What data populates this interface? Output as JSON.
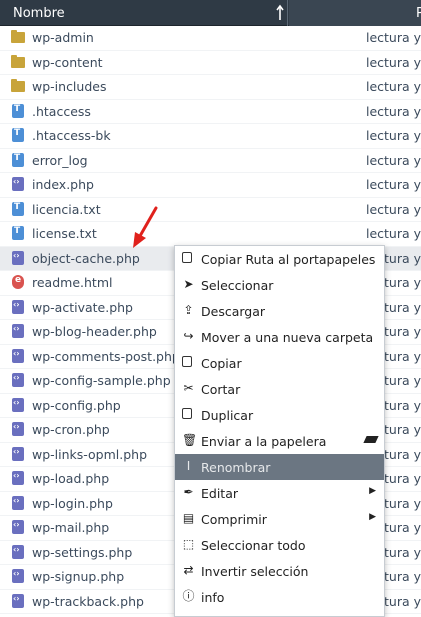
{
  "header": {
    "name_label": "Nombre",
    "perm_label": "P"
  },
  "files": [
    {
      "name": "wp-admin",
      "type": "folder",
      "perm": "lectura y"
    },
    {
      "name": "wp-content",
      "type": "folder",
      "perm": "lectura y"
    },
    {
      "name": "wp-includes",
      "type": "folder",
      "perm": "lectura y"
    },
    {
      "name": ".htaccess",
      "type": "txt",
      "perm": "lectura y"
    },
    {
      "name": ".htaccess-bk",
      "type": "txt",
      "perm": "lectura y"
    },
    {
      "name": "error_log",
      "type": "txt",
      "perm": "lectura y"
    },
    {
      "name": "index.php",
      "type": "php",
      "perm": "lectura y"
    },
    {
      "name": "licencia.txt",
      "type": "txt",
      "perm": "lectura y"
    },
    {
      "name": "license.txt",
      "type": "txt",
      "perm": "lectura y"
    },
    {
      "name": "object-cache.php",
      "type": "php",
      "perm": "lectura y",
      "selected": true
    },
    {
      "name": "readme.html",
      "type": "html",
      "perm": "lectura y"
    },
    {
      "name": "wp-activate.php",
      "type": "php",
      "perm": "lectura y"
    },
    {
      "name": "wp-blog-header.php",
      "type": "php",
      "perm": "lectura y"
    },
    {
      "name": "wp-comments-post.php",
      "type": "php",
      "perm": "lectura y"
    },
    {
      "name": "wp-config-sample.php",
      "type": "php",
      "perm": "lectura y"
    },
    {
      "name": "wp-config.php",
      "type": "php",
      "perm": "lectura y"
    },
    {
      "name": "wp-cron.php",
      "type": "php",
      "perm": "lectura y"
    },
    {
      "name": "wp-links-opml.php",
      "type": "php",
      "perm": "lectura y"
    },
    {
      "name": "wp-load.php",
      "type": "php",
      "perm": "lectura y"
    },
    {
      "name": "wp-login.php",
      "type": "php",
      "perm": "lectura y"
    },
    {
      "name": "wp-mail.php",
      "type": "php",
      "perm": "lectura y"
    },
    {
      "name": "wp-settings.php",
      "type": "php",
      "perm": "lectura y"
    },
    {
      "name": "wp-signup.php",
      "type": "php",
      "perm": "lectura y"
    },
    {
      "name": "wp-trackback.php",
      "type": "php",
      "perm": "lectura y"
    }
  ],
  "context_menu": [
    {
      "label": "Copiar Ruta al portapapeles",
      "icon": "copy-path-icon"
    },
    {
      "label": "Seleccionar",
      "icon": "cursor-icon"
    },
    {
      "label": "Descargar",
      "icon": "download-icon"
    },
    {
      "label": "Mover a una nueva carpeta",
      "icon": "move-icon"
    },
    {
      "label": "Copiar",
      "icon": "copy-icon"
    },
    {
      "label": "Cortar",
      "icon": "scissors-icon"
    },
    {
      "label": "Duplicar",
      "icon": "duplicate-icon"
    },
    {
      "label": "Enviar a la papelera",
      "icon": "trash-icon",
      "extra": "eraser-icon"
    },
    {
      "label": "Renombrar",
      "icon": "text-cursor-icon",
      "highlighted": true
    },
    {
      "label": "Editar",
      "icon": "feather-icon",
      "submenu": true
    },
    {
      "label": "Comprimir",
      "icon": "archive-icon",
      "submenu": true
    },
    {
      "label": "Seleccionar todo",
      "icon": "select-all-icon"
    },
    {
      "label": "Invertir selección",
      "icon": "invert-selection-icon"
    },
    {
      "label": "info",
      "icon": "info-icon"
    }
  ],
  "colors": {
    "header_bg": "#2f3a45",
    "selected_row": "#e9ebee",
    "menu_highlight": "#6b7682",
    "arrow": "#e0211c"
  }
}
